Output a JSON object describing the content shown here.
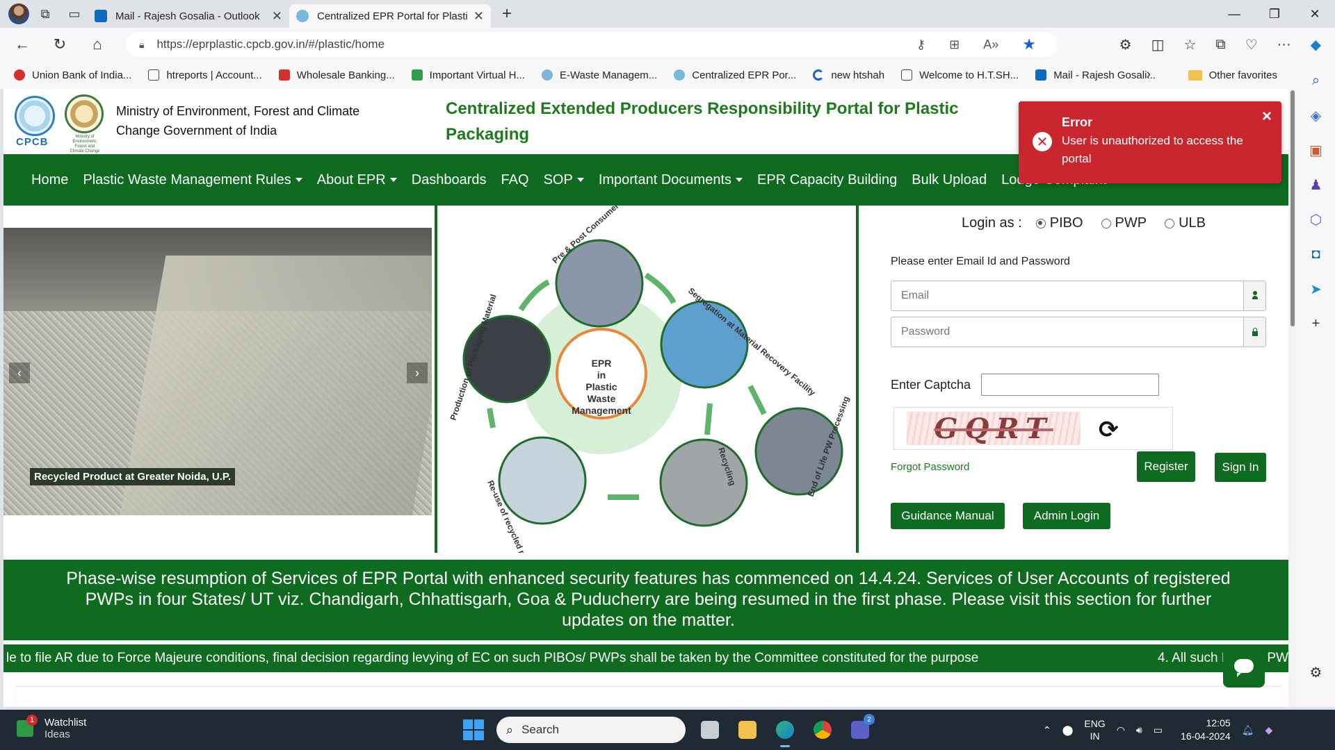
{
  "browser": {
    "tabs": [
      {
        "label": "Mail - Rajesh Gosalia - Outlook",
        "active": false
      },
      {
        "label": "Centralized EPR Portal for Plastic",
        "active": true
      }
    ],
    "url": "https://eprplastic.cpcb.gov.in/#/plastic/home",
    "favorites": [
      {
        "label": "Union Bank of India...",
        "color": "#d32f2f"
      },
      {
        "label": "htreports | Account...",
        "color": "#ffffff"
      },
      {
        "label": "Wholesale Banking...",
        "color": "#d32f2f"
      },
      {
        "label": "Important Virtual H...",
        "color": "#2e9e48"
      },
      {
        "label": "E-Waste Managem...",
        "color": "#7ab8d8"
      },
      {
        "label": "Centralized EPR Por...",
        "color": "#7ab8d8"
      },
      {
        "label": "new htshah",
        "color": "#1a5fd1"
      },
      {
        "label": "Welcome to H.T.SH...",
        "color": "#ffffff"
      },
      {
        "label": "Mail - Rajesh Gosali...",
        "color": "#0f6cbd"
      }
    ],
    "other_favorites": "Other favorites"
  },
  "header": {
    "cpcb_text": "CPCB",
    "moef_text": "Ministry of Environment, Forest and Climate Change",
    "ministry_line1": "Ministry of Environment, Forest and Climate",
    "ministry_line2": "Change Government of India",
    "portal_title": "Centralized Extended Producers Responsibility Portal for Plastic Packaging"
  },
  "nav": {
    "items": [
      {
        "label": "Home",
        "dropdown": false
      },
      {
        "label": "Plastic Waste Management Rules",
        "dropdown": true
      },
      {
        "label": "About EPR",
        "dropdown": true
      },
      {
        "label": "Dashboards",
        "dropdown": false
      },
      {
        "label": "FAQ",
        "dropdown": false
      },
      {
        "label": "SOP",
        "dropdown": true
      },
      {
        "label": "Important Documents",
        "dropdown": true
      },
      {
        "label": "EPR Capacity Building",
        "dropdown": false
      },
      {
        "label": "Bulk Upload",
        "dropdown": false
      },
      {
        "label": "Lodge Complaint",
        "dropdown": false
      }
    ]
  },
  "toast": {
    "title": "Error",
    "message": "User is unauthorized to access the portal",
    "color": "#c9262f"
  },
  "carousel": {
    "caption": "Recycled Product at Greater Noida, U.P."
  },
  "epr_cycle": {
    "center": [
      "EPR",
      "in",
      "Plastic",
      "Waste",
      "Management"
    ],
    "stages": [
      "Pre & Post Consumer Plastic Waste",
      "Segregation at Material Recovery Facility",
      "End of Life PW Processing",
      "Recycling",
      "Re-use of recycled plastic",
      "Production of Packaging Material"
    ]
  },
  "login": {
    "login_as": "Login as :",
    "options": [
      {
        "label": "PIBO",
        "selected": true
      },
      {
        "label": "PWP",
        "selected": false
      },
      {
        "label": "ULB",
        "selected": false
      }
    ],
    "hint": "Please enter Email Id and Password",
    "email_placeholder": "Email",
    "password_placeholder": "Password",
    "captcha_label": "Enter Captcha",
    "captcha_text": "GQRT",
    "forgot": "Forgot Password",
    "register": "Register",
    "signin": "Sign In",
    "guidance": "Guidance Manual",
    "admin": "Admin Login"
  },
  "announcement": "Phase-wise resumption of Services of EPR Portal with enhanced security features has commenced on 14.4.24. Services of User Accounts of registered PWPs in four States/ UT viz. Chandigarh, Chhattisgarh, Goa & Puducherry are being resumed in the first phase. Please visit this section for further updates on the matter.",
  "ticker": {
    "part1": "le to file AR due to Force Majeure conditions, final decision regarding levying of EC on such PIBOs/ PWPs shall be taken by the Committee constituted for the purpose",
    "part2": "4. All such PIBOs/ PW"
  },
  "taskbar": {
    "watchlist": "Watchlist",
    "ideas": "Ideas",
    "badge": "1",
    "search": "Search",
    "teams_badge": "2",
    "lang1": "ENG",
    "lang2": "IN",
    "time": "12:05",
    "date": "16-04-2024"
  },
  "colors": {
    "brand_green": "#0e6b1f",
    "title_green": "#1f7a1f",
    "error_red": "#c9262f"
  }
}
